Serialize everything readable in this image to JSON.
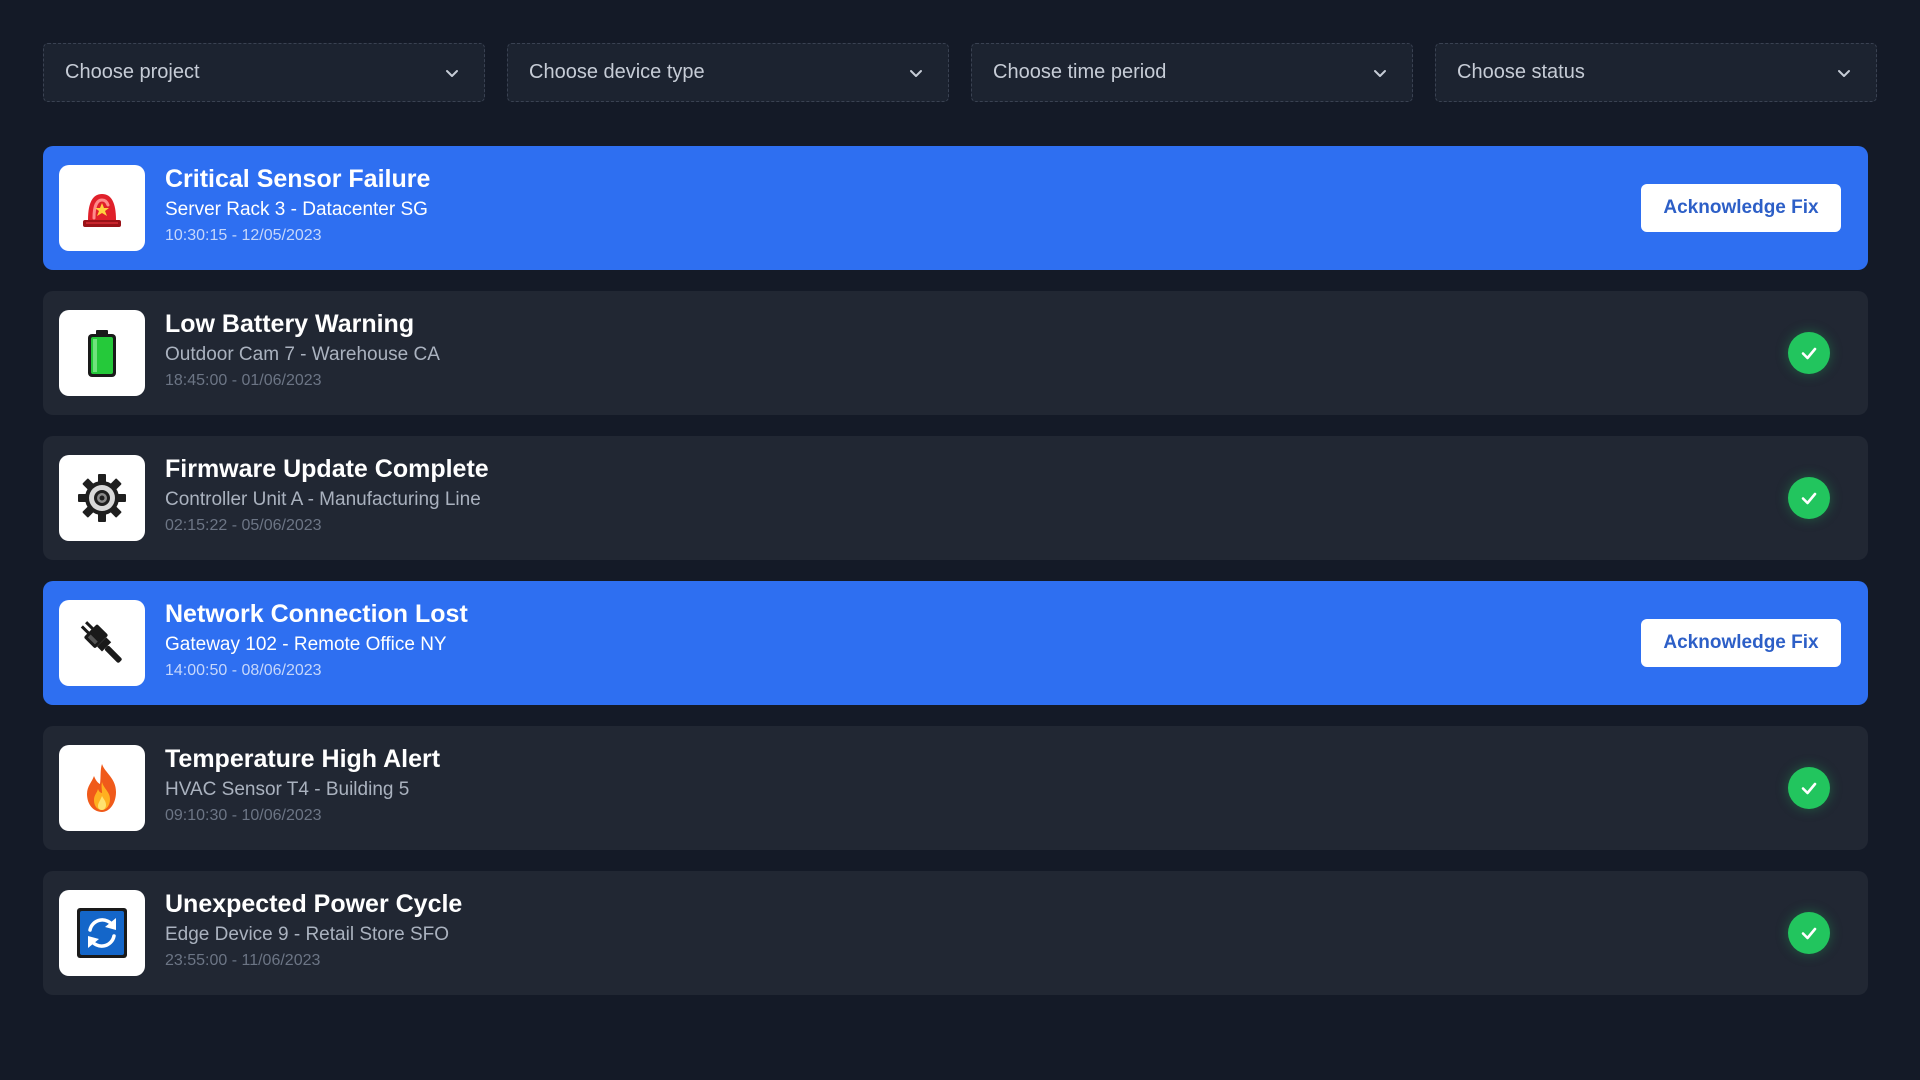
{
  "filters": [
    {
      "label": "Choose project"
    },
    {
      "label": "Choose device type"
    },
    {
      "label": "Choose time period"
    },
    {
      "label": "Choose status"
    }
  ],
  "colors": {
    "background": "#141a27",
    "card": "#212733",
    "active_card": "#2e6ff1",
    "resolved": "#22c55e"
  },
  "alerts": [
    {
      "title": "Critical Sensor Failure",
      "device": "Server Rack 3 - Datacenter SG",
      "time": "10:30:15 - 12/05/2023",
      "icon": "siren-icon",
      "status": "active",
      "action": "Acknowledge Fix"
    },
    {
      "title": "Low Battery Warning",
      "device": "Outdoor Cam 7 - Warehouse CA",
      "time": "18:45:00 - 01/06/2023",
      "icon": "battery-icon",
      "status": "resolved"
    },
    {
      "title": "Firmware Update Complete",
      "device": "Controller Unit A - Manufacturing Line",
      "time": "02:15:22 - 05/06/2023",
      "icon": "gear-icon",
      "status": "resolved"
    },
    {
      "title": "Network Connection Lost",
      "device": "Gateway 102 - Remote Office NY",
      "time": "14:00:50 - 08/06/2023",
      "icon": "plug-icon",
      "status": "active",
      "action": "Acknowledge Fix"
    },
    {
      "title": "Temperature High Alert",
      "device": "HVAC Sensor T4 - Building 5",
      "time": "09:10:30 - 10/06/2023",
      "icon": "fire-icon",
      "status": "resolved"
    },
    {
      "title": "Unexpected Power Cycle",
      "device": "Edge Device 9 - Retail Store SFO",
      "time": "23:55:00 - 11/06/2023",
      "icon": "refresh-icon",
      "status": "resolved"
    }
  ]
}
